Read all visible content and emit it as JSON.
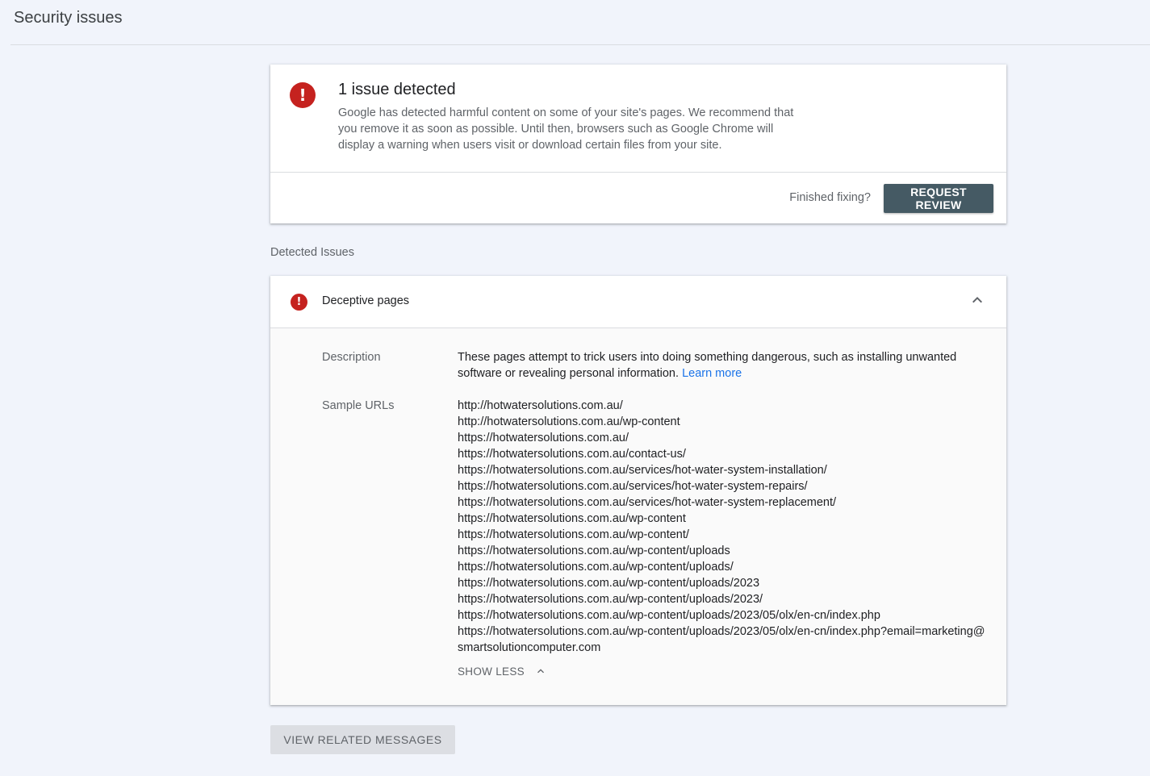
{
  "header": {
    "title": "Security issues"
  },
  "summary": {
    "title": "1 issue detected",
    "description": "Google has detected harmful content on some of your site's pages. We recommend that you remove it as soon as possible. Until then, browsers such as Google Chrome will display a warning when users visit or download certain files from your site.",
    "finished_label": "Finished fixing?",
    "request_review_label": "REQUEST REVIEW",
    "icon": "error-icon",
    "error_color": "#c5221f",
    "button_color": "#455a64"
  },
  "detected_section_label": "Detected Issues",
  "issue": {
    "name": "Deceptive pages",
    "icon": "error-icon",
    "expanded": true,
    "description_label": "Description",
    "description": "These pages attempt to trick users into doing something dangerous, such as installing unwanted software or revealing personal information.",
    "learn_more_label": "Learn more",
    "sample_urls_label": "Sample URLs",
    "sample_urls": [
      "http://hotwatersolutions.com.au/",
      "http://hotwatersolutions.com.au/wp-content",
      "https://hotwatersolutions.com.au/",
      "https://hotwatersolutions.com.au/contact-us/",
      "https://hotwatersolutions.com.au/services/hot-water-system-installation/",
      "https://hotwatersolutions.com.au/services/hot-water-system-repairs/",
      "https://hotwatersolutions.com.au/services/hot-water-system-replacement/",
      "https://hotwatersolutions.com.au/wp-content",
      "https://hotwatersolutions.com.au/wp-content/",
      "https://hotwatersolutions.com.au/wp-content/uploads",
      "https://hotwatersolutions.com.au/wp-content/uploads/",
      "https://hotwatersolutions.com.au/wp-content/uploads/2023",
      "https://hotwatersolutions.com.au/wp-content/uploads/2023/",
      "https://hotwatersolutions.com.au/wp-content/uploads/2023/05/olx/en-cn/index.php",
      "https://hotwatersolutions.com.au/wp-content/uploads/2023/05/olx/en-cn/index.php?email=marketing@smartsolutioncomputer.com"
    ],
    "show_less_label": "SHOW LESS",
    "link_color": "#1a73e8"
  },
  "footer": {
    "view_related_label": "VIEW RELATED MESSAGES"
  }
}
